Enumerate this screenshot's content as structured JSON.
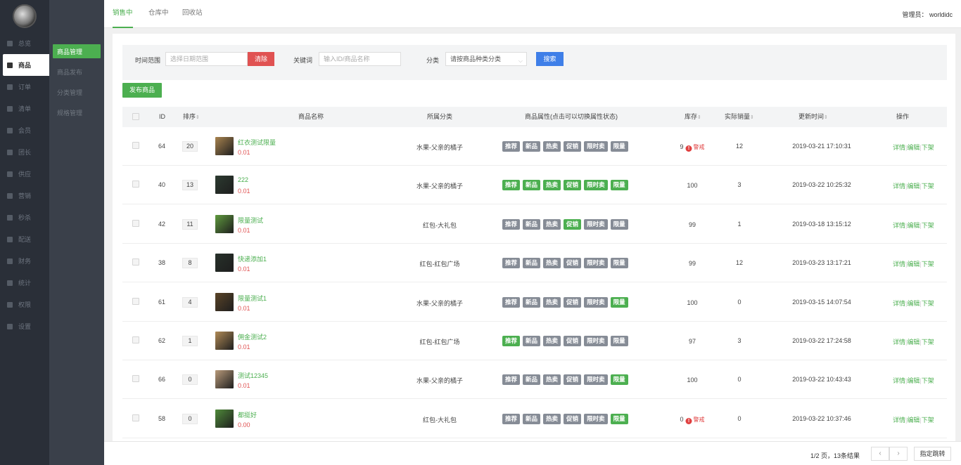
{
  "sidebar": {
    "items": [
      {
        "label": "总览",
        "icon": "grid-icon"
      },
      {
        "label": "商品",
        "icon": "bag-icon",
        "active": true
      },
      {
        "label": "订单",
        "icon": "order-icon"
      },
      {
        "label": "清单",
        "icon": "list-icon"
      },
      {
        "label": "会员",
        "icon": "user-icon"
      },
      {
        "label": "团长",
        "icon": "team-icon"
      },
      {
        "label": "供应",
        "icon": "supply-icon"
      },
      {
        "label": "营销",
        "icon": "chart-icon"
      },
      {
        "label": "秒杀",
        "icon": "flash-icon"
      },
      {
        "label": "配送",
        "icon": "truck-icon"
      },
      {
        "label": "财务",
        "icon": "money-icon"
      },
      {
        "label": "统计",
        "icon": "stats-icon"
      },
      {
        "label": "权限",
        "icon": "key-icon"
      },
      {
        "label": "设置",
        "icon": "gear-icon"
      }
    ]
  },
  "subnav": {
    "items": [
      {
        "label": "商品管理",
        "active": true
      },
      {
        "label": "商品发布"
      },
      {
        "label": "分类管理"
      },
      {
        "label": "规格管理"
      }
    ]
  },
  "topbar": {
    "tabs": [
      "销售中",
      "仓库中",
      "回收站"
    ],
    "admin": "管理员： worldidc"
  },
  "filter": {
    "time_label": "时间范围",
    "time_placeholder": "选择日期范围",
    "clear_label": "清除",
    "keyword_label": "关键词",
    "keyword_placeholder": "输入ID/商品名称",
    "category_label": "分类",
    "category_value": "请按商品种类分类",
    "search_label": "搜索"
  },
  "publish_label": "发布商品",
  "table": {
    "headers": {
      "id": "ID",
      "sort": "排序",
      "name": "商品名称",
      "category": "所属分类",
      "attrs": "商品属性(点击可以切换属性状态)",
      "stock": "库存",
      "sales": "实际销量",
      "updated": "更新时间",
      "ops": "操作"
    },
    "tag_labels": [
      "推荐",
      "新品",
      "热卖",
      "促销",
      "限时卖",
      "限量"
    ],
    "warn_label": "警戒",
    "ops": {
      "detail": "详情",
      "edit": "编辑",
      "offshelf": "下架",
      "sep": "|"
    },
    "rows": [
      {
        "id": "64",
        "sort": "20",
        "name": "红衣测试限量",
        "price": "0.01",
        "category": "水果-父亲的橘子",
        "tags": [
          0,
          0,
          0,
          0,
          0,
          0
        ],
        "stock": "9",
        "warn": true,
        "sales": "12",
        "updated": "2019-03-21 17:10:31",
        "thumb": "#a8834f"
      },
      {
        "id": "40",
        "sort": "13",
        "name": "222",
        "price": "0.01",
        "category": "水果-父亲的橘子",
        "tags": [
          1,
          1,
          1,
          1,
          1,
          1
        ],
        "stock": "100",
        "warn": false,
        "sales": "3",
        "updated": "2019-03-22 10:25:32",
        "thumb": "#2c3a30"
      },
      {
        "id": "42",
        "sort": "11",
        "name": "限量测试",
        "price": "0.01",
        "category": "红包-大礼包",
        "tags": [
          0,
          0,
          0,
          1,
          0,
          0
        ],
        "stock": "99",
        "warn": false,
        "sales": "1",
        "updated": "2019-03-18 13:15:12",
        "thumb": "#5f9a3e"
      },
      {
        "id": "38",
        "sort": "8",
        "name": "快递添加1",
        "price": "0.01",
        "category": "红包-红包广场",
        "tags": [
          0,
          0,
          0,
          0,
          0,
          0
        ],
        "stock": "99",
        "warn": false,
        "sales": "12",
        "updated": "2019-03-23 13:17:21",
        "thumb": "#27312a"
      },
      {
        "id": "61",
        "sort": "4",
        "name": "限量测试1",
        "price": "0.01",
        "category": "水果-父亲的橘子",
        "tags": [
          0,
          0,
          0,
          0,
          0,
          1
        ],
        "stock": "100",
        "warn": false,
        "sales": "0",
        "updated": "2019-03-15 14:07:54",
        "thumb": "#5a4428"
      },
      {
        "id": "62",
        "sort": "1",
        "name": "佣金测试2",
        "price": "0.01",
        "category": "红包-红包广场",
        "tags": [
          1,
          0,
          0,
          0,
          0,
          0
        ],
        "stock": "97",
        "warn": false,
        "sales": "3",
        "updated": "2019-03-22 17:24:58",
        "thumb": "#b08a56"
      },
      {
        "id": "66",
        "sort": "0",
        "name": "测试12345",
        "price": "0.01",
        "category": "水果-父亲的橘子",
        "tags": [
          0,
          0,
          0,
          0,
          0,
          1
        ],
        "stock": "100",
        "warn": false,
        "sales": "0",
        "updated": "2019-03-22 10:43:43",
        "thumb": "#b89a7a"
      },
      {
        "id": "58",
        "sort": "0",
        "name": "都挺好",
        "price": "0.00",
        "category": "红包-大礼包",
        "tags": [
          0,
          0,
          0,
          0,
          0,
          1
        ],
        "stock": "0",
        "warn": true,
        "sales": "0",
        "updated": "2019-03-22 10:37:46",
        "thumb": "#4f8a3a"
      }
    ]
  },
  "pagination": {
    "info": "1/2 页，13条结果",
    "prev": "‹",
    "next": "›",
    "jump_label": "指定跳转"
  }
}
